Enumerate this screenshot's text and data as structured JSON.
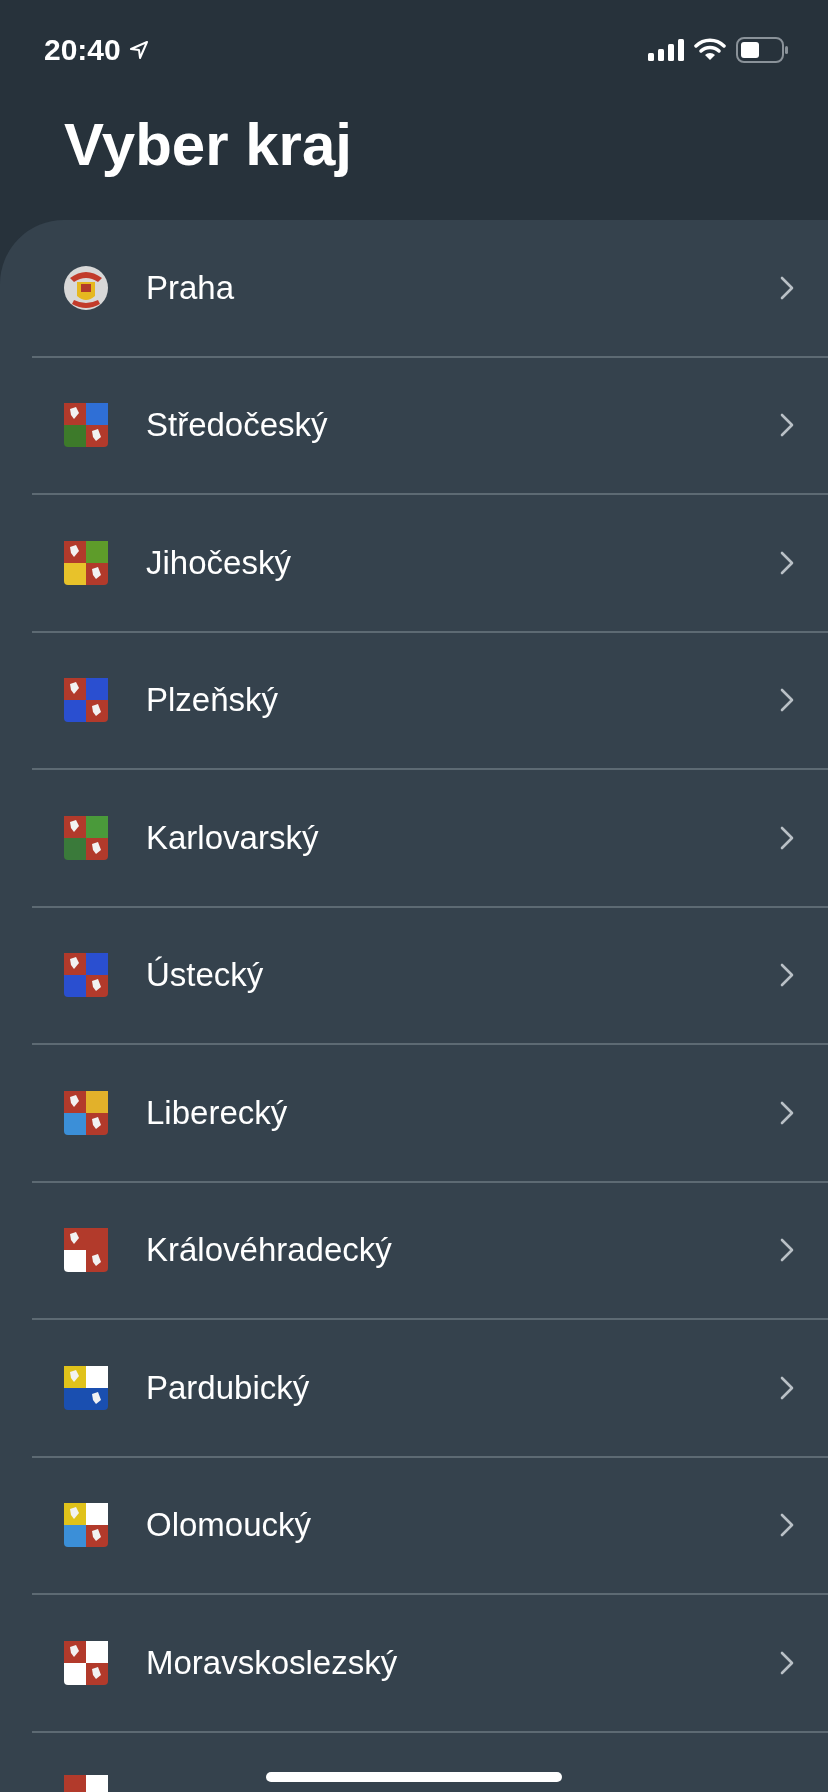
{
  "status_bar": {
    "time": "20:40"
  },
  "title": "Vyber kraj",
  "regions": [
    {
      "name": "Praha",
      "kind": "emblem"
    },
    {
      "name": "Středočeský",
      "kind": "shield"
    },
    {
      "name": "Jihočeský",
      "kind": "shield"
    },
    {
      "name": "Plzeňský",
      "kind": "shield"
    },
    {
      "name": "Karlovarský",
      "kind": "shield"
    },
    {
      "name": "Ústecký",
      "kind": "shield"
    },
    {
      "name": "Liberecký",
      "kind": "shield"
    },
    {
      "name": "Královéhradecký",
      "kind": "shield"
    },
    {
      "name": "Pardubický",
      "kind": "shield"
    },
    {
      "name": "Olomoucký",
      "kind": "shield"
    },
    {
      "name": "Moravskoslezský",
      "kind": "shield"
    }
  ]
}
